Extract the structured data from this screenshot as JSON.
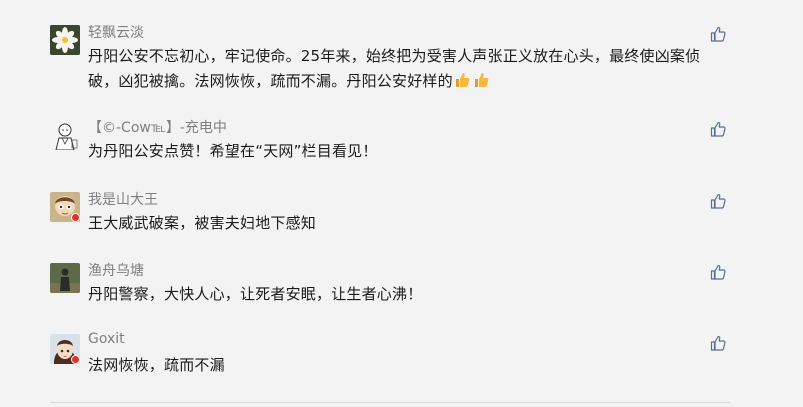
{
  "comments": [
    {
      "nickname": "轻飘云淡",
      "text": "丹阳公安不忘初心，牢记使命。25年来，始终把为受害人声张正义放在心头，最终使凶案侦破，凶犯被擒。法网恢恢，疏而不漏。丹阳公安好样的",
      "emojis": [
        "thumbs-up-emoji",
        "thumbs-up-emoji"
      ],
      "avatar": "white-flower-avatar"
    },
    {
      "nickname": "【©-Cow℡】-充电中",
      "text": "为丹阳公安点赞！希望在“天网”栏目看见！",
      "avatar": "sketch-character-avatar"
    },
    {
      "nickname": "我是山大王",
      "text": "王大威武破案，被害夫妇地下感知",
      "avatar": "cartoon-face-avatar"
    },
    {
      "nickname": "渔舟乌塘",
      "text": "丹阳警察，大快人心，让死者安眠，让生者心沸！",
      "avatar": "person-photo-avatar"
    },
    {
      "nickname": "Goxit",
      "text": "法网恢恢，疏而不漏",
      "avatar": "anime-girl-avatar"
    }
  ],
  "icons": {
    "like": "thumbs-up-icon"
  },
  "colors": {
    "background": "#f3f3f3",
    "nickname": "#7f7f7f",
    "text": "#1a1a1a",
    "icon": "#576b95",
    "badge": "#e0322b"
  }
}
